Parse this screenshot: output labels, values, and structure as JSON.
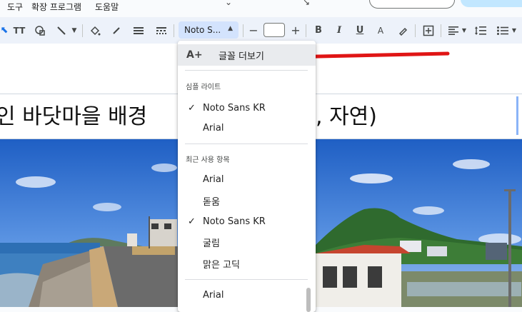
{
  "menu": {
    "items": [
      "도구",
      "확장 프로그램",
      "도움말"
    ]
  },
  "toolbar": {
    "font_name": "Noto S...",
    "text_style_label": "TT",
    "bold": "B",
    "italic": "I",
    "underline": "U",
    "text_color": "A",
    "minus": "−",
    "plus": "+"
  },
  "document": {
    "heading_left": "인 바닷마을 배경",
    "heading_right": ", 자연)"
  },
  "font_menu": {
    "more_fonts": "글꼴 더보기",
    "sections": [
      {
        "heading": "심플 라이트",
        "items": [
          {
            "label": "Noto Sans KR",
            "checked": true
          },
          {
            "label": "Arial",
            "checked": false
          }
        ]
      },
      {
        "heading": "최근 사용 항목",
        "items": [
          {
            "label": "Arial",
            "checked": false
          },
          {
            "label": "돋움",
            "checked": false
          },
          {
            "label": "Noto Sans KR",
            "checked": true
          },
          {
            "label": "굴림",
            "checked": false
          },
          {
            "label": "맑은 고딕",
            "checked": false
          }
        ]
      },
      {
        "heading": "",
        "items": [
          {
            "label": "Arial",
            "checked": false
          }
        ]
      }
    ]
  },
  "annotation": {
    "arrow_color": "#e01515"
  },
  "colors": {
    "accent": "#d3e3fd",
    "toolbar_bg": "#edf2fa"
  }
}
